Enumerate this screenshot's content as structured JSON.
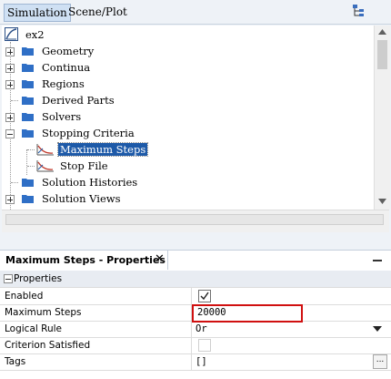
{
  "tabs": {
    "simulation": "Simulation",
    "scene_plot": "Scene/Plot"
  },
  "tree": {
    "root": "ex2",
    "items": [
      {
        "label": "Geometry"
      },
      {
        "label": "Continua"
      },
      {
        "label": "Regions"
      },
      {
        "label": "Derived Parts"
      },
      {
        "label": "Solvers"
      },
      {
        "label": "Stopping Criteria"
      },
      {
        "label": "Maximum Steps"
      },
      {
        "label": "Stop File"
      },
      {
        "label": "Solution Histories"
      },
      {
        "label": "Solution Views"
      }
    ]
  },
  "properties": {
    "panel_title": "Maximum Steps - Properties",
    "close_glyph": "✕",
    "section": "Properties",
    "rows": [
      {
        "name": "Enabled",
        "value": "checked"
      },
      {
        "name": "Maximum Steps",
        "value": "20000"
      },
      {
        "name": "Logical Rule",
        "value": "Or"
      },
      {
        "name": "Criterion Satisfied",
        "value": "unchecked"
      },
      {
        "name": "Tags",
        "value": "[]"
      }
    ],
    "tags_button": "..."
  },
  "colors": {
    "selection": "#1e5aa8",
    "highlight_border": "#d01010",
    "folder": "#2f6fc6"
  }
}
